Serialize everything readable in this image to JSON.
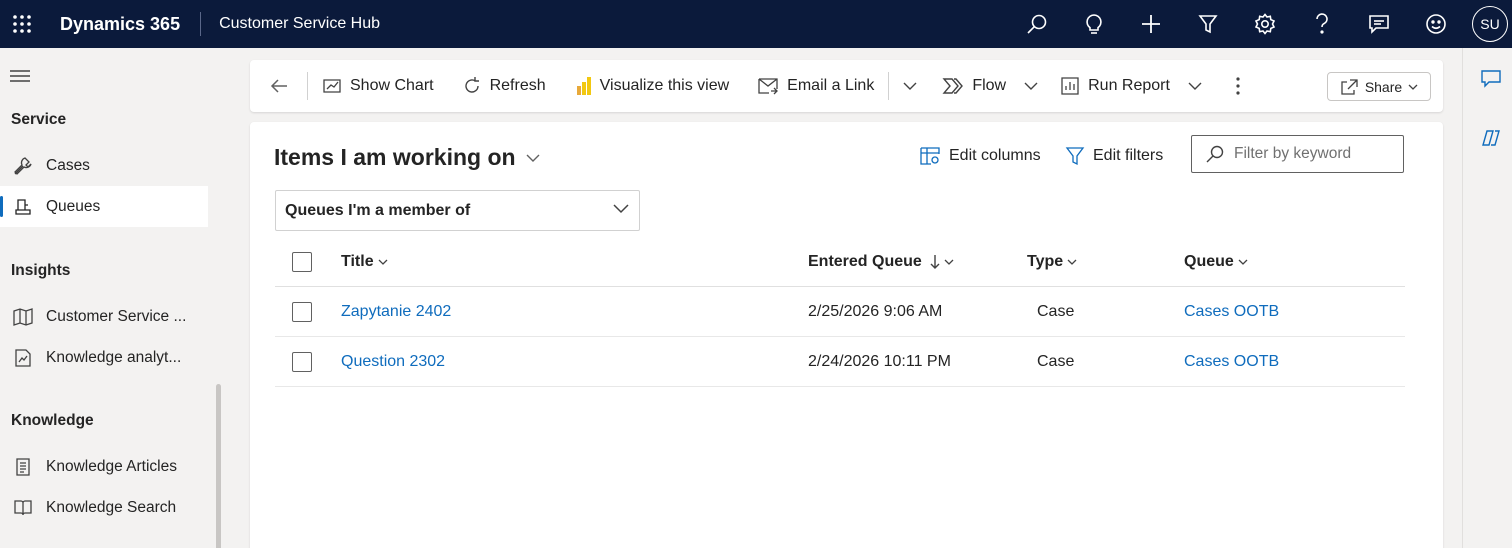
{
  "topbar": {
    "brand": "Dynamics 365",
    "app_name": "Customer Service Hub",
    "avatar_initials": "SU",
    "background": "#0b1a3b"
  },
  "sidebar": {
    "groups": [
      {
        "label": "Service",
        "items": [
          {
            "label": "Cases",
            "icon": "wrench-icon"
          },
          {
            "label": "Queues",
            "icon": "queue-icon",
            "active": true
          }
        ]
      },
      {
        "label": "Insights",
        "items": [
          {
            "label": "Customer Service ...",
            "icon": "dashboard-icon"
          },
          {
            "label": "Knowledge analyt...",
            "icon": "analytics-icon"
          }
        ]
      },
      {
        "label": "Knowledge",
        "items": [
          {
            "label": "Knowledge Articles",
            "icon": "article-icon"
          },
          {
            "label": "Knowledge Search",
            "icon": "book-icon"
          }
        ]
      }
    ]
  },
  "commandbar": {
    "show_chart": "Show Chart",
    "refresh": "Refresh",
    "visualize": "Visualize this view",
    "email_link": "Email a Link",
    "flow": "Flow",
    "run_report": "Run Report",
    "share": "Share"
  },
  "view": {
    "title": "Items I am working on",
    "edit_columns": "Edit columns",
    "edit_filters": "Edit filters",
    "filter_placeholder": "Filter by keyword",
    "queue_filter": "Queues I'm a member of"
  },
  "grid": {
    "columns": {
      "title": "Title",
      "entered_queue": "Entered Queue",
      "type": "Type",
      "queue": "Queue"
    },
    "rows": [
      {
        "title": "Zapytanie 2402",
        "entered_queue": "2/25/2026 9:06 AM",
        "type": "Case",
        "queue": "Cases OOTB"
      },
      {
        "title": "Question 2302",
        "entered_queue": "2/24/2026 10:11 PM",
        "type": "Case",
        "queue": "Cases OOTB"
      }
    ]
  },
  "colors": {
    "accent": "#0f6cbd",
    "link": "#0f6cbd"
  }
}
